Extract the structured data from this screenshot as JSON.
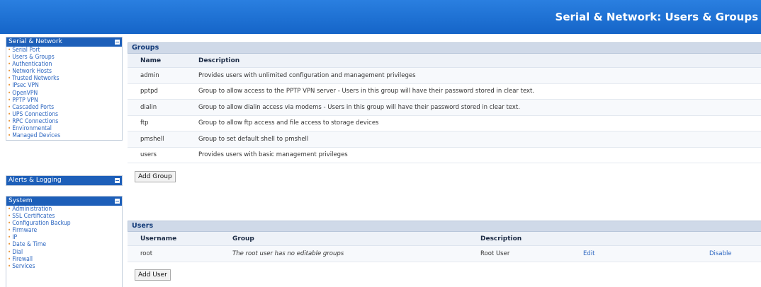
{
  "header": {
    "title": "Serial & Network: Users & Groups"
  },
  "sidebar": {
    "serial_network": {
      "title": "Serial & Network",
      "items": [
        "Serial Port",
        "Users & Groups",
        "Authentication",
        "Network Hosts",
        "Trusted Networks",
        "IPsec VPN",
        "OpenVPN",
        "PPTP VPN",
        "Cascaded Ports",
        "UPS Connections",
        "RPC Connections",
        "Environmental",
        "Managed Devices"
      ]
    },
    "alerts_logging": {
      "title": "Alerts & Logging"
    },
    "system": {
      "title": "System",
      "items": [
        "Administration",
        "SSL Certificates",
        "Configuration Backup",
        "Firmware",
        "IP",
        "Date & Time",
        "Dial",
        "Firewall",
        "Services"
      ]
    }
  },
  "groups": {
    "title": "Groups",
    "columns": {
      "name": "Name",
      "description": "Description"
    },
    "rows": [
      {
        "name": "admin",
        "description": "Provides users with unlimited configuration and management privileges"
      },
      {
        "name": "pptpd",
        "description": "Group to allow access to the PPTP VPN server - Users in this group will have their password stored in clear text."
      },
      {
        "name": "dialin",
        "description": "Group to allow dialin access via modems - Users in this group will have their password stored in clear text."
      },
      {
        "name": "ftp",
        "description": "Group to allow ftp access and file access to storage devices"
      },
      {
        "name": "pmshell",
        "description": "Group to set default shell to pmshell"
      },
      {
        "name": "users",
        "description": "Provides users with basic management privileges"
      }
    ],
    "add_button": "Add Group"
  },
  "users": {
    "title": "Users",
    "columns": {
      "username": "Username",
      "group": "Group",
      "description": "Description"
    },
    "rows": [
      {
        "username": "root",
        "group": "The root user has no editable groups",
        "description": "Root User",
        "edit": "Edit",
        "disable": "Disable"
      }
    ],
    "add_button": "Add User"
  }
}
